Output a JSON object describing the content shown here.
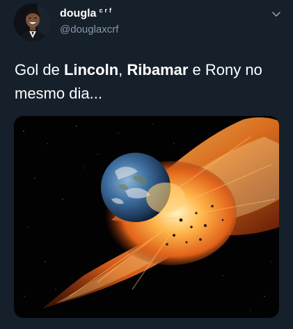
{
  "author": {
    "display_name": "dougla",
    "name_superscript": "crf",
    "handle": "@douglaxcrf",
    "avatar_icon": "avatar-photo"
  },
  "menu": {
    "icon": "chevron-down-icon"
  },
  "tweet": {
    "text_parts": [
      {
        "text": "Gol de ",
        "bold": false
      },
      {
        "text": "Lincoln",
        "bold": true
      },
      {
        "text": ", ",
        "bold": false
      },
      {
        "text": "Ribamar",
        "bold": true
      },
      {
        "text": " e Rony no mesmo dia...",
        "bold": false
      }
    ]
  },
  "media": {
    "icon": "earth-explosion-image"
  },
  "colors": {
    "background": "#15202b",
    "text": "#ffffff",
    "secondary_text": "#8899a6",
    "fire": "#ff8a1e"
  }
}
